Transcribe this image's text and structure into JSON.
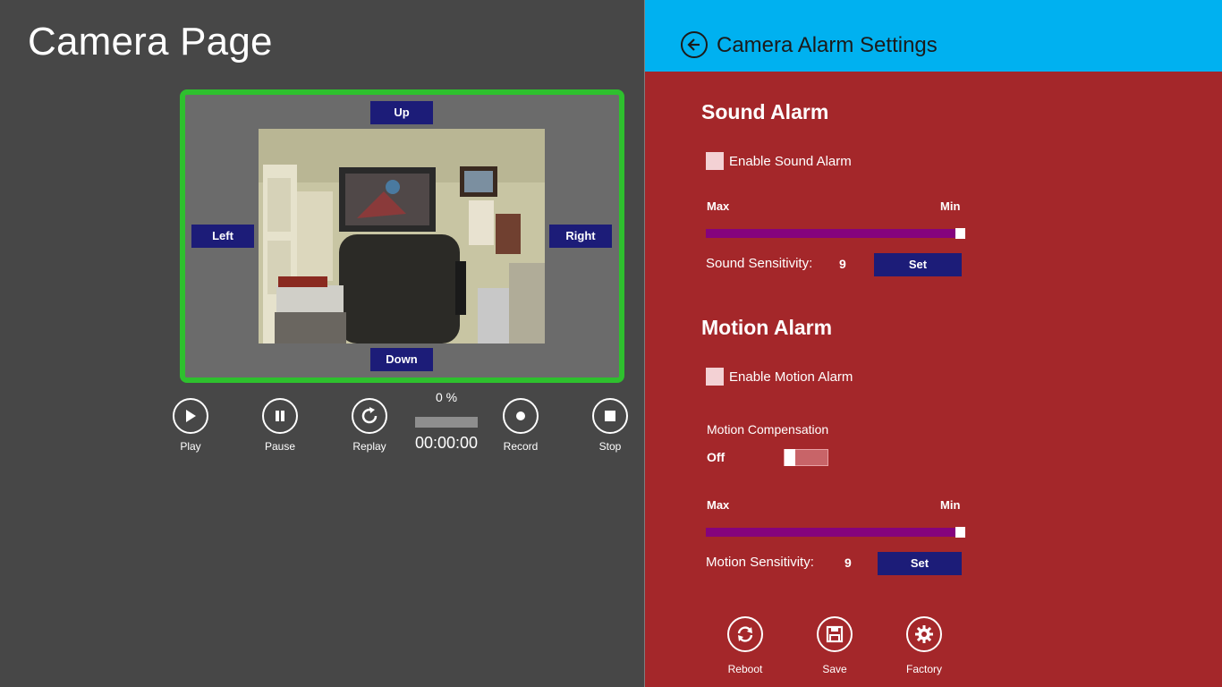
{
  "left": {
    "title": "Camera Page",
    "ptz": {
      "up": "Up",
      "down": "Down",
      "left": "Left",
      "right": "Right"
    },
    "controls": [
      {
        "label": "Play",
        "icon": "play-icon"
      },
      {
        "label": "Pause",
        "icon": "pause-icon"
      },
      {
        "label": "Replay",
        "icon": "replay-icon"
      },
      {
        "label": "Record",
        "icon": "record-icon"
      },
      {
        "label": "Stop",
        "icon": "stop-icon"
      }
    ],
    "progress": {
      "percent_text": "0 %",
      "value": 0,
      "time": "00:00:00"
    },
    "frame_color": "#2ec02e"
  },
  "right": {
    "header_title": "Camera Alarm Settings",
    "header_color": "#00b1f0",
    "panel_color": "#a4272a",
    "sound": {
      "title": "Sound Alarm",
      "enable_label": "Enable Sound Alarm",
      "enabled": false,
      "max_label": "Max",
      "min_label": "Min",
      "slider_value": 1.0,
      "sensitivity_label": "Sound Sensitivity:",
      "sensitivity_value": "9",
      "set_label": "Set"
    },
    "motion": {
      "title": "Motion Alarm",
      "enable_label": "Enable Motion Alarm",
      "enabled": false,
      "compensation_label": "Motion Compensation",
      "compensation_state": "Off",
      "max_label": "Max",
      "min_label": "Min",
      "slider_value": 1.0,
      "sensitivity_label": "Motion Sensitivity:",
      "sensitivity_value": "9",
      "set_label": "Set"
    },
    "actions": [
      {
        "label": "Reboot",
        "icon": "reboot-icon"
      },
      {
        "label": "Save",
        "icon": "save-icon"
      },
      {
        "label": "Factory",
        "icon": "gear-icon"
      }
    ]
  }
}
